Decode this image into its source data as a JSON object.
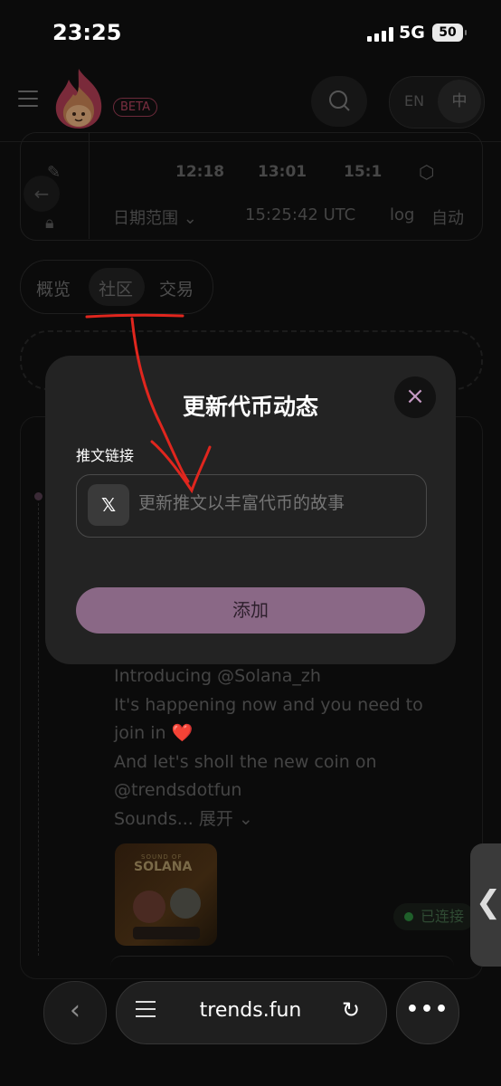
{
  "status_bar": {
    "time": "23:25",
    "network": "5G",
    "battery": "50"
  },
  "header": {
    "beta_badge": "BETA",
    "lang_en": "EN",
    "lang_zh": "中"
  },
  "chart_card": {
    "times": [
      "12:18",
      "13:01",
      "15:1"
    ],
    "date_range": "日期范围 ⌄",
    "utc_time": "15:25:42 UTC",
    "log_label": "log",
    "auto_label": "自动"
  },
  "tabs": [
    {
      "label": "概览"
    },
    {
      "label": "社区"
    },
    {
      "label": "交易"
    }
  ],
  "modal": {
    "title": "更新代币动态",
    "close_icon": "×",
    "field_label": "推文链接",
    "x_icon": "𝕏",
    "placeholder": "更新推文以丰富代币的故事",
    "add_button": "添加"
  },
  "post": {
    "line1": "Introducing @Solana_zh",
    "line2": "It's happening now and you need to join in",
    "heart": "❤️",
    "line3": "And let's sholl the new coin on @trendsdotfun",
    "line4": "Sounds... 展开 ⌄",
    "thumb_label_small": "SOUND OF",
    "thumb_label_big": "SOLANA"
  },
  "connected_badge": "已连接",
  "side_handle": "❮",
  "browser": {
    "url": "trends.fun",
    "back_glyph": "‹",
    "more_glyph": "•••",
    "reload_glyph": "↻"
  },
  "colors": {
    "accent": "#8a6886",
    "annotation_red": "#e0261e",
    "close_icon": "#c59ac4"
  }
}
